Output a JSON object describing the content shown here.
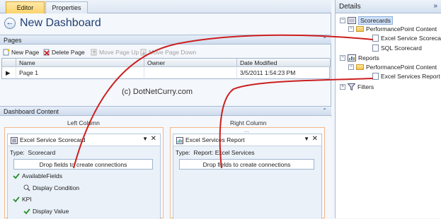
{
  "tabs": [
    {
      "label": "Editor",
      "active": true
    },
    {
      "label": "Properties",
      "active": false
    }
  ],
  "page_title": "New Dashboard",
  "pages_section": {
    "title": "Pages"
  },
  "toolbar": {
    "new_page": "New Page",
    "delete_page": "Delete Page",
    "move_up": "Move Page Up",
    "move_down": "Move Page Down"
  },
  "grid": {
    "columns": [
      "Name",
      "Owner",
      "Date Modified"
    ],
    "rows": [
      {
        "name": "Page 1",
        "owner": "",
        "modified": "3/5/2011 1:54:23 PM"
      }
    ]
  },
  "watermark": "(c) DotNetCurry.com",
  "content_section": {
    "title": "Dashboard Content"
  },
  "columns": {
    "left": {
      "header": "Left Column",
      "part_title": "Excel Service Scorecard",
      "type_label": "Type:",
      "type_value": "Scorecard",
      "drop_text": "Drop fields to create connections",
      "fields": [
        "AvailableFields",
        "Display Condition",
        "KPI",
        "Display Value"
      ]
    },
    "right": {
      "header": "Right Column",
      "part_title": "Excel Services Report",
      "type_label": "Type:",
      "type_value": "Report: Excel Services",
      "drop_text": "Drop fields to create connections"
    }
  },
  "details": {
    "title": "Details",
    "collapse_glyph": "»",
    "tree": {
      "scorecards": "Scorecards",
      "ppc1": "PerformancePoint Content",
      "excel_scorecard": "Excel Service Scorecar",
      "sql_scorecard": "SQL Scorecard",
      "reports": "Reports",
      "ppc2": "PerformancePoint Content",
      "excel_report": "Excel Services Report",
      "filters": "Filters"
    }
  },
  "colors": {
    "accent_tab": "#fcd36a",
    "arrow": "#cc1f1f",
    "title": "#1e3f73"
  }
}
